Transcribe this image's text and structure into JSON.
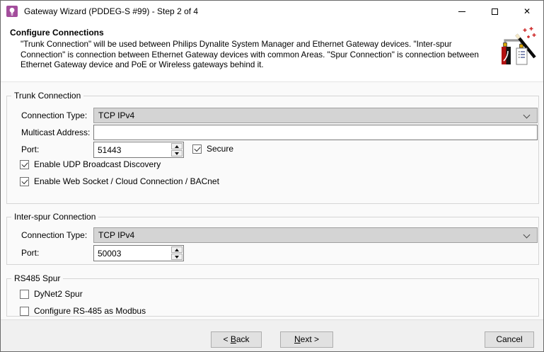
{
  "window": {
    "title": "Gateway Wizard (PDDEG-S #99) - Step 2 of 4",
    "close_glyph": "✕"
  },
  "icons": {
    "app": "lightbulb-icon",
    "minimize": "minimize-icon",
    "maximize": "maximize-icon",
    "close": "close-icon",
    "combo_chevron": "chevron-down-icon",
    "spinner_up": "triangle-up-icon",
    "spinner_down": "triangle-down-icon",
    "wizard_art": "magic-wand-devices-icon"
  },
  "header": {
    "title": "Configure Connections",
    "description": "\"Trunk Connection\" will be used between Philips Dynalite System Manager and Ethernet Gateway devices. \"Inter-spur Connection\" is connection between Ethernet Gateway devices with common Areas. \"Spur Connection\" is connection between Ethernet Gateway device and PoE or Wireless gateways behind it."
  },
  "trunk": {
    "legend": "Trunk Connection",
    "connection_type_label": "Connection Type:",
    "connection_type_value": "TCP IPv4",
    "multicast_label": "Multicast Address:",
    "multicast_value": "",
    "port_label": "Port:",
    "port_value": "51443",
    "secure": {
      "label": "Secure",
      "checked": true
    },
    "checkboxes": [
      {
        "label": "Enable UDP Broadcast Discovery",
        "checked": true
      },
      {
        "label": "Enable Web Socket / Cloud Connection / BACnet",
        "checked": true
      }
    ]
  },
  "interspur": {
    "legend": "Inter-spur Connection",
    "connection_type_label": "Connection Type:",
    "connection_type_value": "TCP IPv4",
    "port_label": "Port:",
    "port_value": "50003"
  },
  "rs485": {
    "legend": "RS485 Spur",
    "checkboxes": [
      {
        "label": "DyNet2 Spur",
        "checked": false
      },
      {
        "label": "Configure RS-485 as Modbus",
        "checked": false
      }
    ]
  },
  "footer": {
    "back": {
      "pre": "< ",
      "mnemonic": "B",
      "rest": "ack"
    },
    "next": {
      "pre": "",
      "mnemonic": "N",
      "rest": "ext >"
    },
    "cancel": {
      "label": "Cancel"
    }
  },
  "colors": {
    "accent": "#A34D9C",
    "window_border": "#6A6A6A",
    "footer_bg": "#F0F0F0",
    "combo_bg": "#D4D4D4",
    "button_bg": "#E1E1E1",
    "button_border": "#ADADAD"
  }
}
